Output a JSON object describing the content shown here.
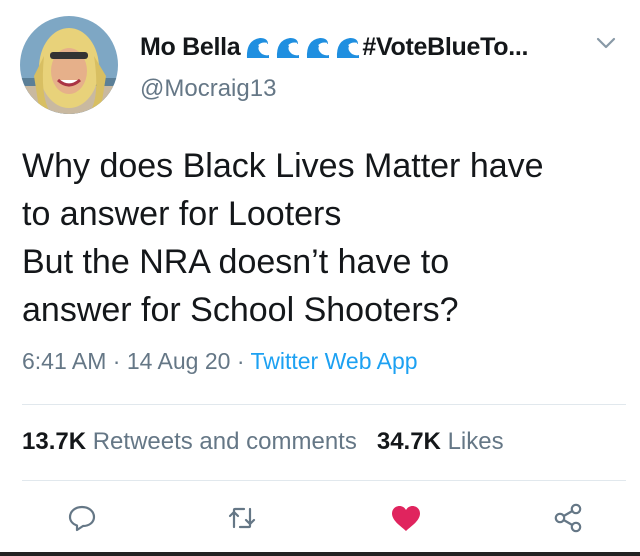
{
  "user": {
    "display_name": "Mo Bella",
    "name_suffix": "#VoteBlueTo...",
    "handle": "@Mocraig13",
    "emoji": [
      "water-wave",
      "water-wave",
      "water-wave",
      "water-wave"
    ]
  },
  "tweet": {
    "lines": [
      "Why does Black Lives Matter have",
      "to answer for Looters",
      "But the NRA doesn’t have to",
      "answer for School Shooters?"
    ],
    "time": "6:41 AM",
    "sep1": " · ",
    "date": "14 Aug 20",
    "sep2": " · ",
    "source": "Twitter Web App"
  },
  "stats": {
    "retweets_count": "13.7K",
    "retweets_label": "Retweets and comments",
    "likes_count": "34.7K",
    "likes_label": "Likes"
  },
  "actions": {
    "reply_icon": "speech-bubble-icon",
    "retweet_icon": "retweet-icon",
    "like_icon": "heart-icon",
    "share_icon": "share-icon"
  },
  "colors": {
    "link": "#1da1f2",
    "secondary": "#657786",
    "like": "#e0245e"
  }
}
